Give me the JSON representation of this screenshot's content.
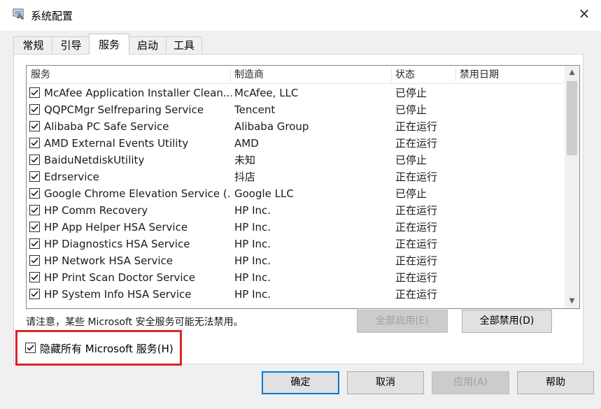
{
  "window": {
    "title": "系统配置",
    "close_icon": "×"
  },
  "tabs": [
    {
      "label": "常规",
      "active": false
    },
    {
      "label": "引导",
      "active": false
    },
    {
      "label": "服务",
      "active": true
    },
    {
      "label": "启动",
      "active": false
    },
    {
      "label": "工具",
      "active": false
    }
  ],
  "columns": {
    "service": "服务",
    "vendor": "制造商",
    "status": "状态",
    "disable_date": "禁用日期"
  },
  "services": [
    {
      "name": "McAfee Application Installer Clean...",
      "vendor": "McAfee, LLC",
      "status": "已停止",
      "checked": true
    },
    {
      "name": "QQPCMgr Selfreparing Service",
      "vendor": "Tencent",
      "status": "已停止",
      "checked": true
    },
    {
      "name": "Alibaba PC Safe Service",
      "vendor": "Alibaba Group",
      "status": "正在运行",
      "checked": true
    },
    {
      "name": "AMD External Events Utility",
      "vendor": "AMD",
      "status": "正在运行",
      "checked": true
    },
    {
      "name": "BaiduNetdiskUtility",
      "vendor": "未知",
      "status": "已停止",
      "checked": true
    },
    {
      "name": "Edrservice",
      "vendor": "抖店",
      "status": "正在运行",
      "checked": true
    },
    {
      "name": "Google Chrome Elevation Service (...",
      "vendor": "Google LLC",
      "status": "已停止",
      "checked": true
    },
    {
      "name": "HP Comm Recovery",
      "vendor": "HP Inc.",
      "status": "正在运行",
      "checked": true
    },
    {
      "name": "HP App Helper HSA Service",
      "vendor": "HP Inc.",
      "status": "正在运行",
      "checked": true
    },
    {
      "name": "HP Diagnostics HSA Service",
      "vendor": "HP Inc.",
      "status": "正在运行",
      "checked": true
    },
    {
      "name": "HP Network HSA Service",
      "vendor": "HP Inc.",
      "status": "正在运行",
      "checked": true
    },
    {
      "name": "HP Print Scan Doctor Service",
      "vendor": "HP Inc.",
      "status": "正在运行",
      "checked": true
    },
    {
      "name": "HP System Info HSA Service",
      "vendor": "HP Inc.",
      "status": "正在运行",
      "checked": true
    }
  ],
  "note": "请注意，某些 Microsoft 安全服务可能无法禁用。",
  "buttons": {
    "enable_all": "全部启用(E)",
    "disable_all": "全部禁用(D)",
    "ok": "确定",
    "cancel": "取消",
    "apply": "应用(A)",
    "help": "帮助"
  },
  "hide_ms": {
    "label": "隐藏所有 Microsoft 服务(H)",
    "checked": true
  },
  "colors": {
    "highlight": "#d9262b",
    "focus": "#0078d7"
  }
}
